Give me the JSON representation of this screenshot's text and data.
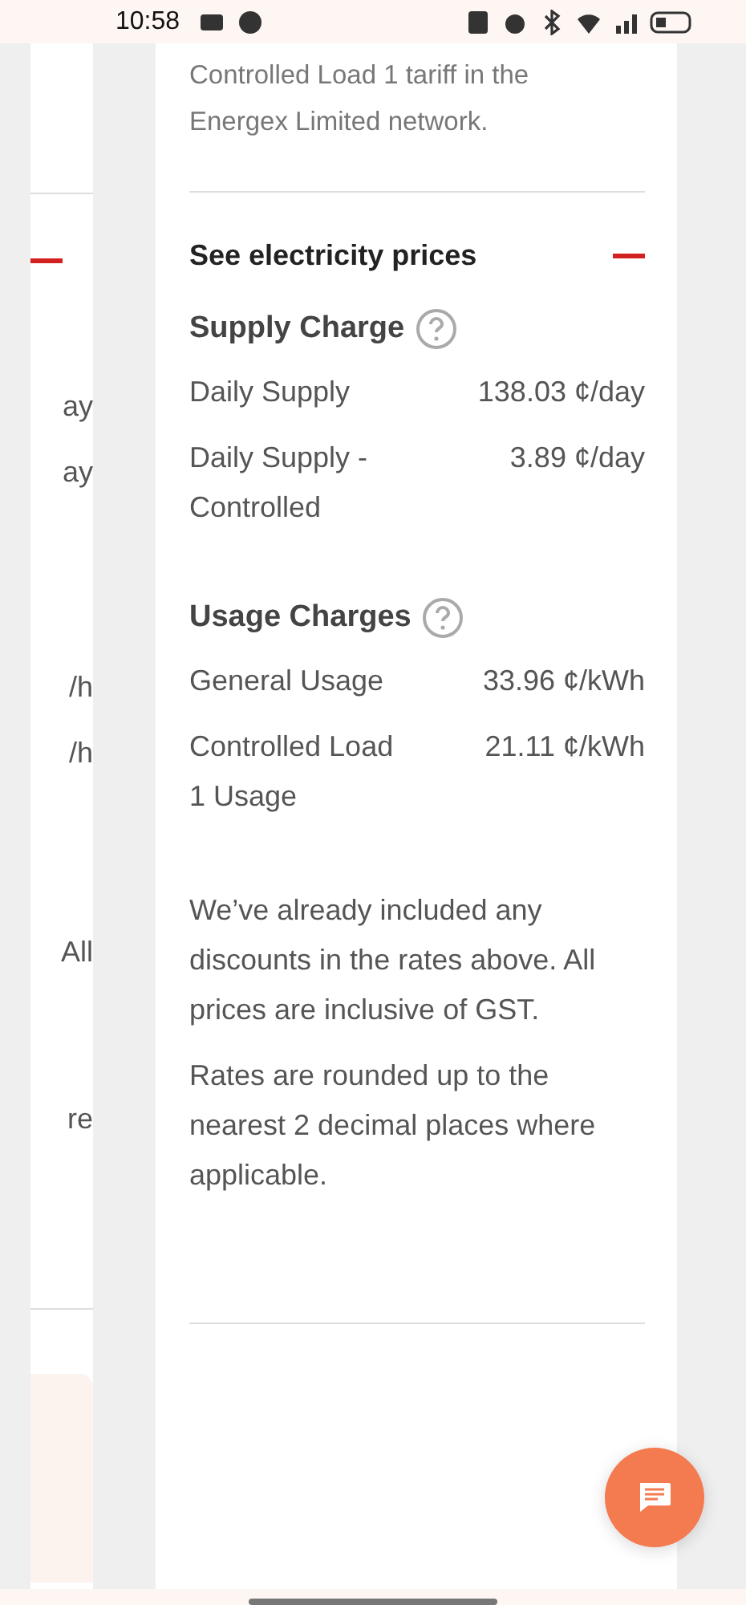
{
  "status_bar": {
    "time": "10:58"
  },
  "left_card": {
    "collapse_shown": true,
    "fragments": [
      "ay",
      "ay",
      "/h",
      "/h",
      "All",
      "re"
    ]
  },
  "intro_lines": [
    "Controlled Load 1 tariff in the",
    "Energex Limited network."
  ],
  "prices": {
    "title": "See electricity prices",
    "expanded": true,
    "sections": [
      {
        "title": "Supply Charge",
        "rows": [
          {
            "label": "Daily Supply",
            "value": "138.03 ¢/day"
          },
          {
            "label": "Daily Supply - Controlled",
            "value": "3.89 ¢/day"
          }
        ]
      },
      {
        "title": "Usage Charges",
        "rows": [
          {
            "label": "General Usage",
            "value": "33.96 ¢/kWh"
          },
          {
            "label": "Controlled Load 1 Usage",
            "value": "21.11 ¢/kWh"
          }
        ]
      }
    ],
    "notes": [
      "We’ve already included any discounts in the rates above. All prices are inclusive of GST.",
      "Rates are rounded up to the nearest 2 decimal places where applicable."
    ]
  }
}
